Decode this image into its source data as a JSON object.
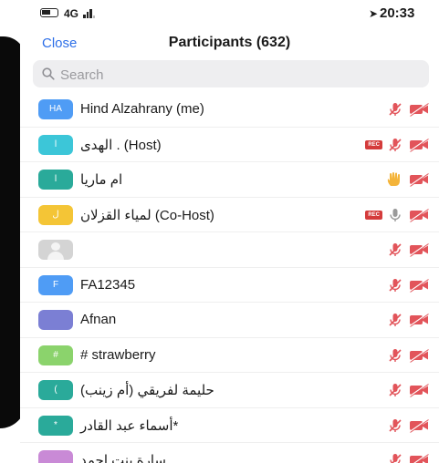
{
  "status_bar": {
    "network": "4G",
    "time": "20:33"
  },
  "header": {
    "close_label": "Close",
    "title": "Participants (632)"
  },
  "search": {
    "placeholder": "Search"
  },
  "colors": {
    "accent": "#2d6fe8",
    "muted_red": "#e2545a",
    "hand_yellow": "#f4b43a"
  },
  "participants": [
    {
      "initials": "HA",
      "name": "Hind Alzahrany (me)",
      "avatar_color": "#4f9cf5",
      "rec": false,
      "audio": "muted",
      "video": "off"
    },
    {
      "initials": "ا",
      "name": "الهدى . (Host)",
      "avatar_color": "#3cc6d8",
      "rec": true,
      "rec_label": "REC",
      "audio": "muted",
      "video": "off"
    },
    {
      "initials": "ا",
      "name": "ام ماريا",
      "avatar_color": "#2aaa9a",
      "rec": false,
      "audio": "raised-hand",
      "video": "off"
    },
    {
      "initials": "ل",
      "name": "لمياء القزلان (Co-Host)",
      "avatar_color": "#f4c536",
      "rec": true,
      "rec_label": "REC",
      "audio": "on",
      "video": "off"
    },
    {
      "initials": "",
      "name": "",
      "avatar_color": "#d4d4d4",
      "placeholder": true,
      "rec": false,
      "audio": "muted",
      "video": "off"
    },
    {
      "initials": "F",
      "name": "FA12345",
      "avatar_color": "#4f9cf5",
      "rec": false,
      "audio": "muted",
      "video": "off"
    },
    {
      "initials": "",
      "name": "Afnan",
      "avatar_color": "#7b7fd4",
      "rec": false,
      "audio": "muted",
      "video": "off"
    },
    {
      "initials": "#",
      "name": "# strawberry",
      "avatar_color": "#8bd36c",
      "rec": false,
      "audio": "muted",
      "video": "off"
    },
    {
      "initials": "(",
      "name": "(حليمة لفريقي (أم زينب",
      "avatar_color": "#2aaa9a",
      "rec": false,
      "audio": "muted",
      "video": "off"
    },
    {
      "initials": "*",
      "name": "أسماء عبد القادر*",
      "avatar_color": "#2aaa9a",
      "rec": false,
      "audio": "muted",
      "video": "off"
    },
    {
      "initials": "",
      "name": "سارة بنت احمد",
      "avatar_color": "#c98ad6",
      "rec": false,
      "audio": "muted",
      "video": "off"
    }
  ]
}
